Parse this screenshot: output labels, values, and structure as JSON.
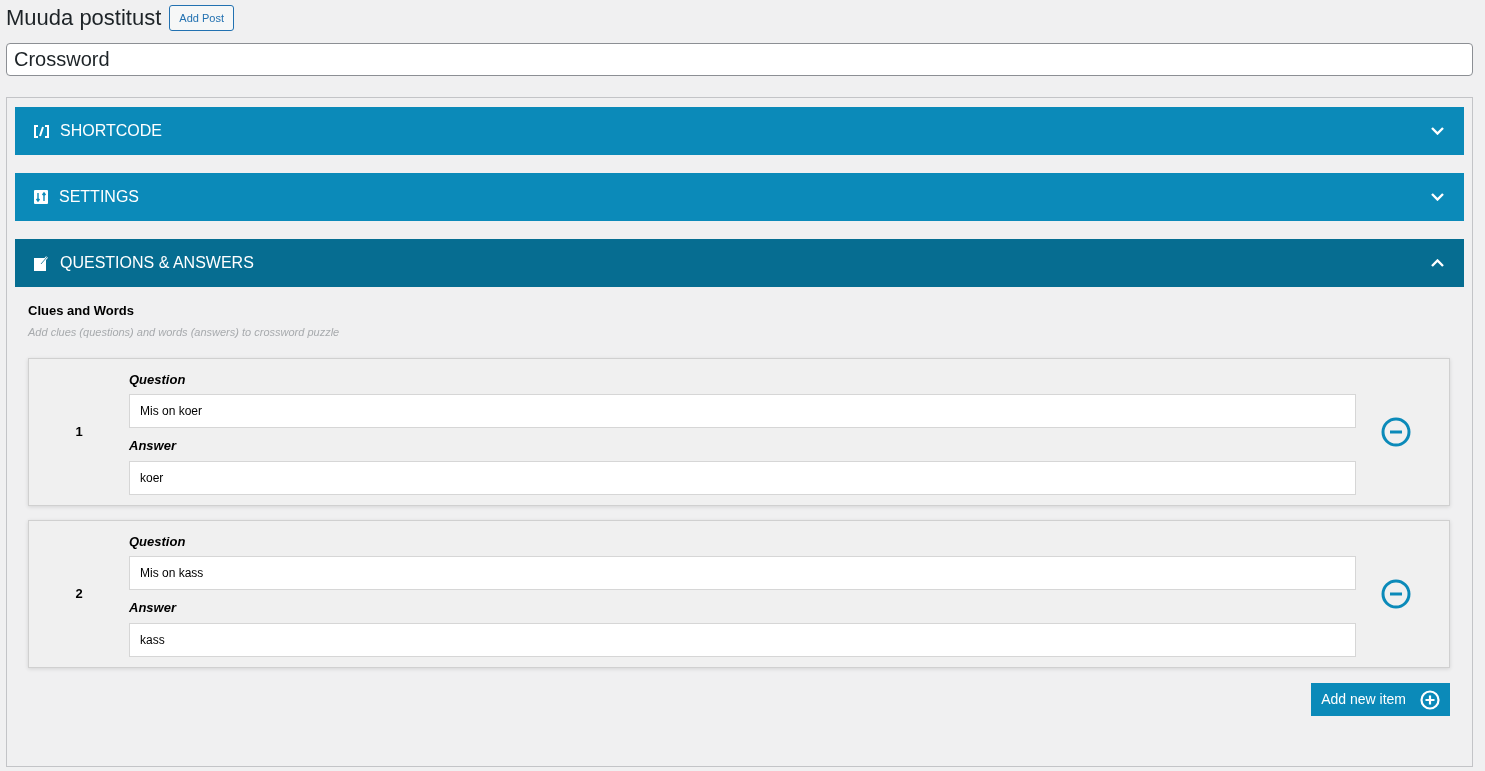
{
  "page_title": "Muuda postitust",
  "add_post_button": "Add Post",
  "post_title": {
    "value": "Crossword"
  },
  "sections": [
    {
      "title": "SHORTCODE",
      "kind": "code",
      "expanded": false
    },
    {
      "title": "SETTINGS",
      "kind": "settings",
      "expanded": false
    },
    {
      "title": "QUESTIONS & ANSWERS",
      "kind": "edit",
      "expanded": true
    }
  ],
  "clues": {
    "heading": "Clues and Words",
    "description": "Add clues (questions) and words (answers) to crossword puzzle",
    "items": [
      {
        "number": "1",
        "question_label": "Question",
        "question": "Mis on koer",
        "answer_label": "Answer",
        "answer": "koer"
      },
      {
        "number": "2",
        "question_label": "Question",
        "question": "Mis on kass",
        "answer_label": "Answer",
        "answer": "kass"
      }
    ],
    "add_button": "Add new item"
  }
}
